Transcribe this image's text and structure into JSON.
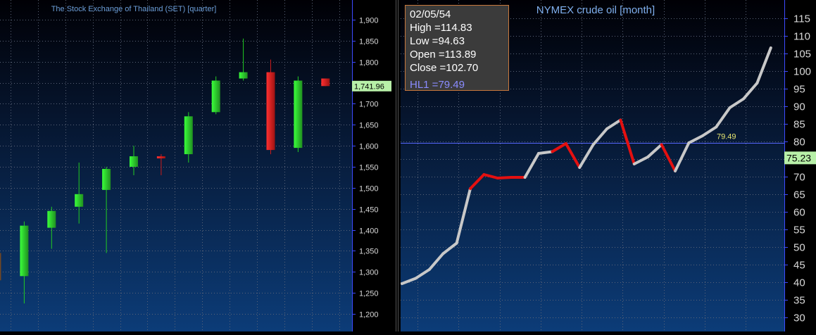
{
  "chart_data": [
    {
      "type": "candlestick",
      "title": "The Stock Exchange of Thailand (SET) [quarter]",
      "y_ticks": [
        "1,900",
        "1,850",
        "1,800",
        "1,750",
        "1,700",
        "1,650",
        "1,600",
        "1,550",
        "1,500",
        "1,450",
        "1,400",
        "1,350",
        "1,300",
        "1,250",
        "1,200"
      ],
      "ylim": [
        1165,
        1940
      ],
      "last_price_label": "1,741.96",
      "last_price": 1741.96,
      "grid": true,
      "candles": [
        {
          "open": 1345,
          "close": 1280,
          "high": 1345,
          "low": 1280
        },
        {
          "open": 1290,
          "close": 1410,
          "high": 1420,
          "low": 1225
        },
        {
          "open": 1405,
          "close": 1445,
          "high": 1455,
          "low": 1355
        },
        {
          "open": 1455,
          "close": 1485,
          "high": 1560,
          "low": 1415
        },
        {
          "open": 1495,
          "close": 1545,
          "high": 1550,
          "low": 1345
        },
        {
          "open": 1550,
          "close": 1575,
          "high": 1600,
          "low": 1530
        },
        {
          "open": 1575,
          "close": 1570,
          "high": 1580,
          "low": 1530
        },
        {
          "open": 1580,
          "close": 1670,
          "high": 1680,
          "low": 1560
        },
        {
          "open": 1680,
          "close": 1755,
          "high": 1765,
          "low": 1675
        },
        {
          "open": 1760,
          "close": 1775,
          "high": 1855,
          "low": 1755
        },
        {
          "open": 1775,
          "close": 1590,
          "high": 1805,
          "low": 1580
        },
        {
          "open": 1595,
          "close": 1755,
          "high": 1765,
          "low": 1585
        },
        {
          "open": 1760,
          "close": 1742,
          "high": 1760,
          "low": 1742
        }
      ]
    },
    {
      "type": "line",
      "title": "NYMEX crude oil [month]",
      "y_ticks": [
        "115",
        "110",
        "105",
        "100",
        "95",
        "90",
        "85",
        "80",
        "75",
        "70",
        "65",
        "60",
        "55",
        "50",
        "45",
        "40",
        "35",
        "30"
      ],
      "ylim": [
        26.5,
        119.5
      ],
      "last_price_label": "75.23",
      "last_price": 75.23,
      "hline": {
        "label": "79.49",
        "value": 79.49
      },
      "grid": true,
      "values": [
        39.5,
        41,
        43.5,
        48,
        51,
        66.5,
        70.5,
        69.5,
        69.7,
        69.7,
        76.5,
        77,
        79.3,
        72.5,
        79,
        83.5,
        86,
        73.5,
        75.5,
        79,
        71.5,
        79.5,
        81.5,
        84,
        89.5,
        92,
        96.5,
        106.5
      ],
      "down_segments": [
        5,
        6,
        7,
        8,
        11,
        12,
        16,
        19
      ]
    }
  ],
  "tooltip": {
    "date": "02/05/54",
    "high": "High =114.83",
    "low": "Low =94.63",
    "open": "Open =113.89",
    "close": "Close =102.70",
    "hl": "HL1 =79.49"
  },
  "colors": {
    "up_candle": "#22cc22",
    "down_candle": "#cc1c1c",
    "line": "#c8c8c8",
    "line_down": "#e41010",
    "price_label_bg": "#b8f0a8",
    "hline": "#5566ff",
    "hline_label": "#e8e870",
    "title_left": "#6c9ed8",
    "title_right": "#80b0ee"
  }
}
